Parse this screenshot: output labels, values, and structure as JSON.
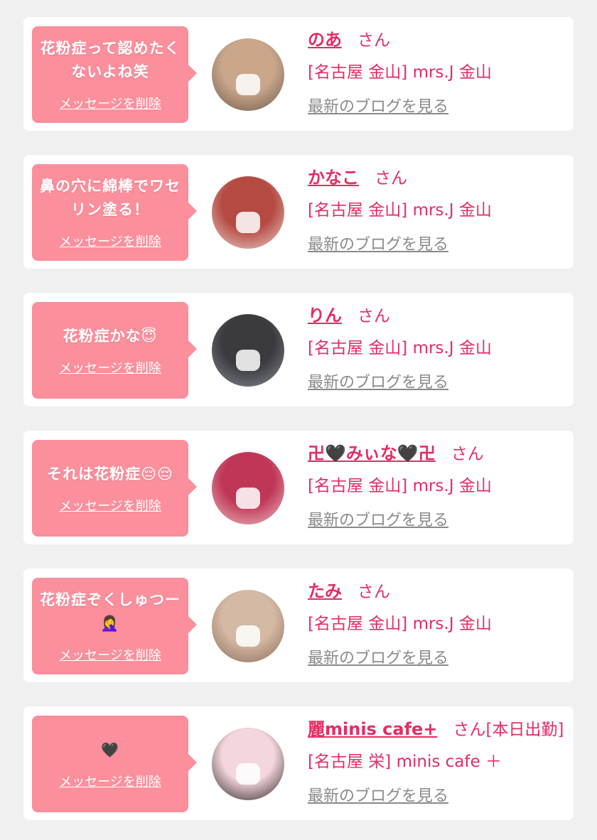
{
  "delete_label": "メッセージを削除",
  "blog_label": "最新のブログを見る",
  "colors": {
    "page_background": "#f0f0f0",
    "card_background": "#ffffff",
    "bubble": "#fb8f9c",
    "name_text": "#e32d63",
    "blog_link": "#8a8a8a"
  },
  "messages": [
    {
      "bubble_text": "花粉症って認めたくないよね笑",
      "name": "のあ",
      "suffix": "さん",
      "shop": "[名古屋 金山] mrs.J 金山",
      "avatar_colors": [
        "#caa78b",
        "#6e5a4c"
      ]
    },
    {
      "bubble_text": "鼻の穴に綿棒でワセリン塗る！",
      "name": "かなこ",
      "suffix": "さん",
      "shop": "[名古屋 金山] mrs.J 金山",
      "avatar_colors": [
        "#b54a43",
        "#e9d2c8"
      ]
    },
    {
      "bubble_text": "花粉症かな😇",
      "name": "りん",
      "suffix": "さん",
      "shop": "[名古屋 金山] mrs.J 金山",
      "avatar_colors": [
        "#3a3a3f",
        "#8a8a95"
      ]
    },
    {
      "bubble_text": "それは花粉症😔😔",
      "name": "卍🖤みぃな🖤卍",
      "suffix": "さん",
      "shop": "[名古屋 金山] mrs.J 金山",
      "avatar_colors": [
        "#c03656",
        "#ecc1c7"
      ]
    },
    {
      "bubble_text": "花粉症ぞくしゅつー🤦‍♀️",
      "name": "たみ",
      "suffix": "さん",
      "shop": "[名古屋 金山] mrs.J 金山",
      "avatar_colors": [
        "#d4b9a4",
        "#8c6b57"
      ]
    },
    {
      "bubble_text": "🖤",
      "name": "麗minis cafe+",
      "suffix": "さん[本日出勤]",
      "shop": "[名古屋 栄] minis cafe ＋",
      "avatar_colors": [
        "#f4d7dc",
        "#2a2224"
      ]
    }
  ]
}
